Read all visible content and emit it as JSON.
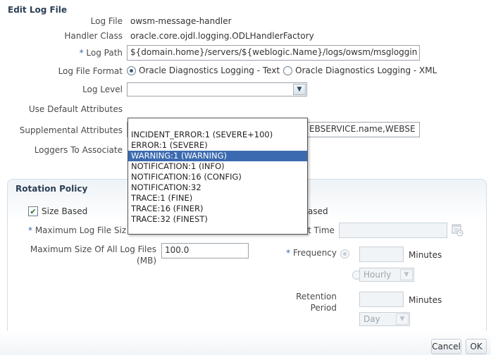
{
  "dialog": {
    "title": "Edit Log File"
  },
  "form": {
    "log_file_label": "Log File",
    "log_file_value": "owsm-message-handler",
    "handler_class_label": "Handler Class",
    "handler_class_value": "oracle.core.ojdl.logging.ODLHandlerFactory",
    "log_path_required": "*",
    "log_path_label": "Log Path",
    "log_path_value": "${domain.home}/servers/${weblogic.Name}/logs/owsm/msgloggin",
    "log_file_format_label": "Log File Format",
    "format_options": [
      "Oracle Diagnostics Logging - Text",
      "Oracle Diagnostics Logging - XML"
    ],
    "format_selected": "Oracle Diagnostics Logging - Text",
    "log_level_label": "Log Level",
    "log_level_value": "",
    "use_default_attributes_label": "Use Default Attributes",
    "supplemental_attributes_label": "Supplemental Attributes",
    "supplemental_attributes_value": "EBSERVICE.name,WEBSE",
    "loggers_to_associate_label": "Loggers To Associate"
  },
  "log_level_dropdown": {
    "options": [
      "INCIDENT_ERROR:1 (SEVERE+100)",
      "ERROR:1 (SEVERE)",
      "WARNING:1 (WARNING)",
      "NOTIFICATION:1 (INFO)",
      "NOTIFICATION:16 (CONFIG)",
      "NOTIFICATION:32",
      "TRACE:1 (FINE)",
      "TRACE:16 (FINER)",
      "TRACE:32 (FINEST)"
    ],
    "highlighted": "WARNING:1 (WARNING)"
  },
  "rotation_policy": {
    "title": "Rotation Policy",
    "size_based_label": "Size Based",
    "size_based_checked": true,
    "max_log_file_size_required": "*",
    "max_log_file_size_label": "Maximum Log File Siz",
    "max_size_all_label_line1": "Maximum Size Of All Log Files",
    "max_size_all_label_line2": "(MB)",
    "max_size_all_value": "100.0",
    "time_based_label_fragment": "ased",
    "start_time_label_fragment": "t Time",
    "frequency_required": "*",
    "frequency_label": "Frequency",
    "frequency_unit": "Minutes",
    "frequency_period_value": "Hourly",
    "retention_label_line1": "Retention",
    "retention_label_line2": "Period",
    "retention_unit": "Minutes",
    "retention_period_value": "Day"
  },
  "buttons": {
    "cancel": "Cancel",
    "ok": "OK"
  },
  "icons": {
    "calendar": "calendar-icon",
    "dropdown": "chevron-down-icon",
    "check": "checkmark-icon"
  },
  "colors": {
    "accent": "#3b6ab0",
    "title": "#2b3e55"
  }
}
